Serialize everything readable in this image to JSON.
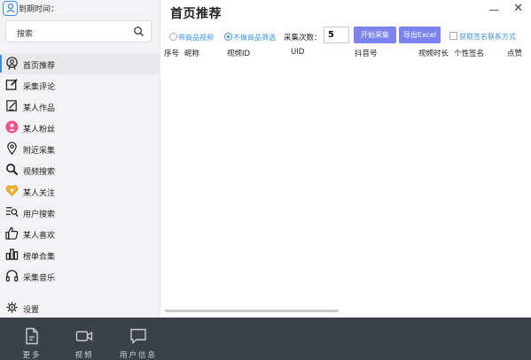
{
  "header": {
    "expire_label": "到期时间：",
    "search_placeholder": "搜索"
  },
  "sidebar": {
    "items": [
      {
        "label": "首页推荐",
        "icon": "user-badge-icon",
        "active": true
      },
      {
        "label": "采集评论",
        "icon": "edit-icon"
      },
      {
        "label": "某人作品",
        "icon": "doc-edit-icon"
      },
      {
        "label": "某人粉丝",
        "icon": "pink-user-icon"
      },
      {
        "label": "附近采集",
        "icon": "location-pin-icon"
      },
      {
        "label": "视频搜索",
        "icon": "search-icon"
      },
      {
        "label": "某人关注",
        "icon": "heart-icon"
      },
      {
        "label": "用户搜索",
        "icon": "list-search-icon"
      },
      {
        "label": "某人喜欢",
        "icon": "thumb-up-icon"
      },
      {
        "label": "榜单合集",
        "icon": "bar-chart-icon"
      },
      {
        "label": "采集音乐",
        "icon": "headphones-icon"
      }
    ],
    "settings_label": "设置"
  },
  "main": {
    "title": "首页推荐",
    "radio_goods": "带商品视频",
    "radio_no_filter": "不做商品筛选",
    "count_label": "采集次数：",
    "count_value": "5",
    "start_button": "开始采集",
    "export_button": "导出Excel",
    "checkbox_label": "获取签名联系方式",
    "columns": [
      "序号",
      "昵称",
      "视频ID",
      "UID",
      "抖音号",
      "视频时长",
      "个性签名",
      "点赞"
    ]
  },
  "bottom_bar": {
    "items": [
      {
        "label": "更多",
        "icon": "document-icon"
      },
      {
        "label": "视频",
        "icon": "video-camera-icon"
      },
      {
        "label": "用户信息",
        "icon": "chat-bubble-icon"
      }
    ]
  },
  "colors": {
    "accent": "#3b8fe3",
    "button": "#7d83ee",
    "bottom_bar": "#3c4049",
    "sidebar_bg": "#f3f3f5"
  }
}
